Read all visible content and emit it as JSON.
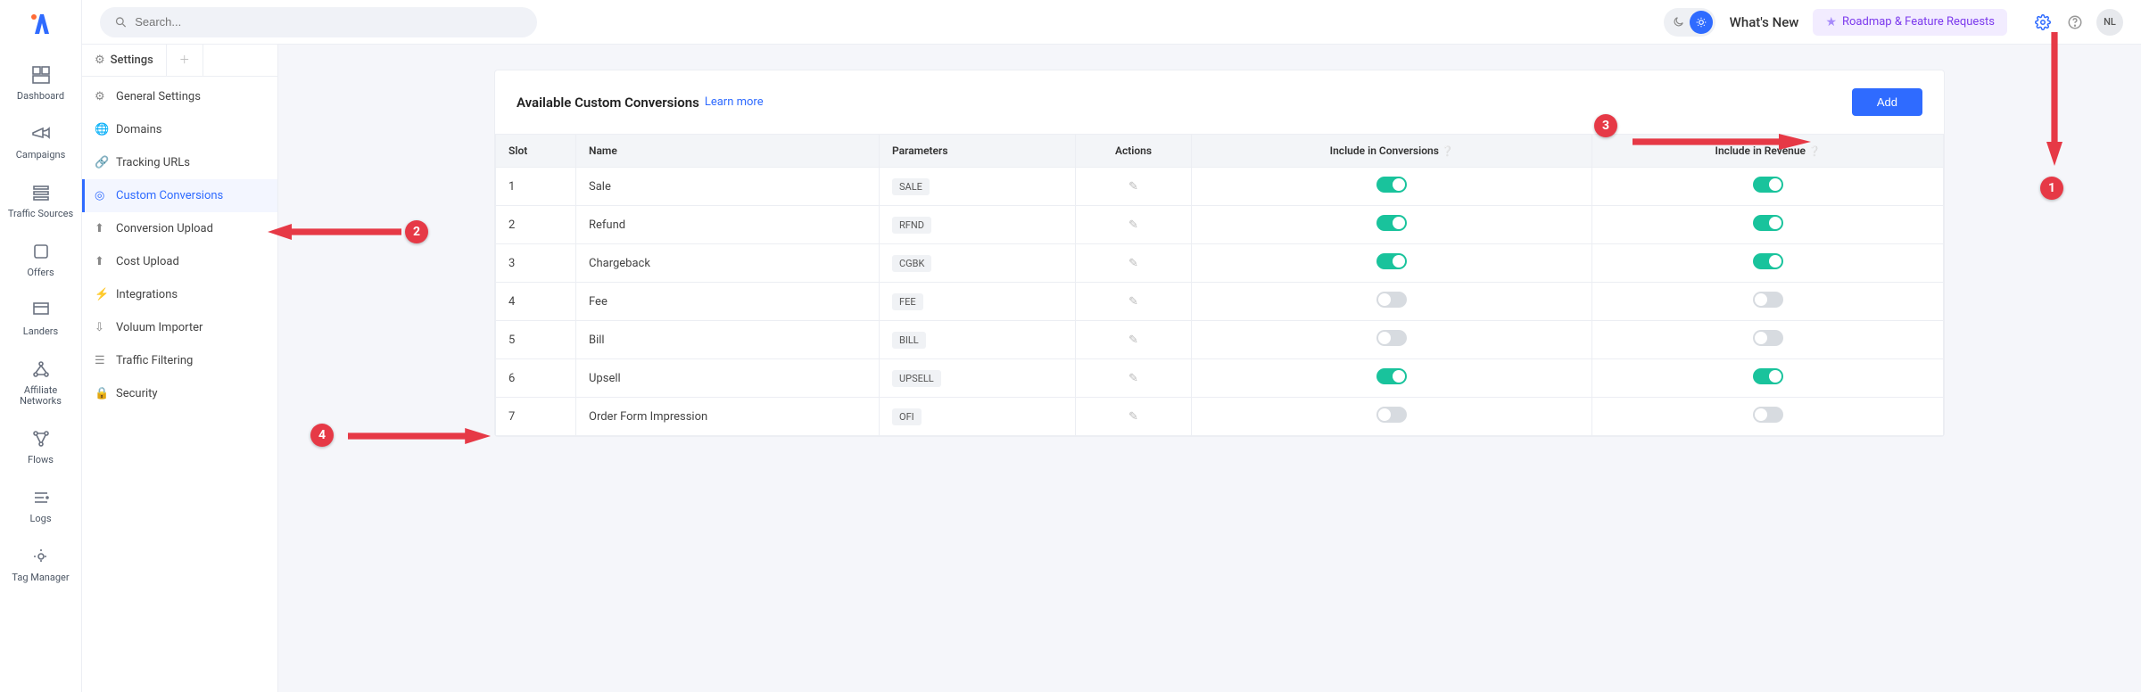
{
  "search": {
    "placeholder": "Search..."
  },
  "topbar": {
    "whats_new": "What's New",
    "roadmap_label": "Roadmap & Feature Requests",
    "avatar_initials": "NL"
  },
  "rail": {
    "items": [
      {
        "label": "Dashboard"
      },
      {
        "label": "Campaigns"
      },
      {
        "label": "Traffic Sources"
      },
      {
        "label": "Offers"
      },
      {
        "label": "Landers"
      },
      {
        "label": "Affiliate Networks"
      },
      {
        "label": "Flows"
      },
      {
        "label": "Logs"
      },
      {
        "label": "Tag Manager"
      }
    ]
  },
  "sidebar": {
    "tab_label": "Settings",
    "items": [
      {
        "label": "General Settings"
      },
      {
        "label": "Domains"
      },
      {
        "label": "Tracking URLs"
      },
      {
        "label": "Custom Conversions"
      },
      {
        "label": "Conversion Upload"
      },
      {
        "label": "Cost Upload"
      },
      {
        "label": "Integrations"
      },
      {
        "label": "Voluum Importer"
      },
      {
        "label": "Traffic Filtering"
      },
      {
        "label": "Security"
      }
    ]
  },
  "panel": {
    "title": "Available Custom Conversions",
    "learn_more": "Learn more",
    "add_button": "Add",
    "columns": {
      "slot": "Slot",
      "name": "Name",
      "parameters": "Parameters",
      "actions": "Actions",
      "include_conv": "Include in Conversions",
      "include_rev": "Include in Revenue"
    },
    "rows": [
      {
        "slot": "1",
        "name": "Sale",
        "param": "SALE",
        "conv": true,
        "rev": true
      },
      {
        "slot": "2",
        "name": "Refund",
        "param": "RFND",
        "conv": true,
        "rev": true
      },
      {
        "slot": "3",
        "name": "Chargeback",
        "param": "CGBK",
        "conv": true,
        "rev": true
      },
      {
        "slot": "4",
        "name": "Fee",
        "param": "FEE",
        "conv": false,
        "rev": false
      },
      {
        "slot": "5",
        "name": "Bill",
        "param": "BILL",
        "conv": false,
        "rev": false
      },
      {
        "slot": "6",
        "name": "Upsell",
        "param": "UPSELL",
        "conv": true,
        "rev": true
      },
      {
        "slot": "7",
        "name": "Order Form Impression",
        "param": "OFI",
        "conv": false,
        "rev": false
      }
    ]
  },
  "annotations": {
    "b1": "1",
    "b2": "2",
    "b3": "3",
    "b4": "4"
  }
}
